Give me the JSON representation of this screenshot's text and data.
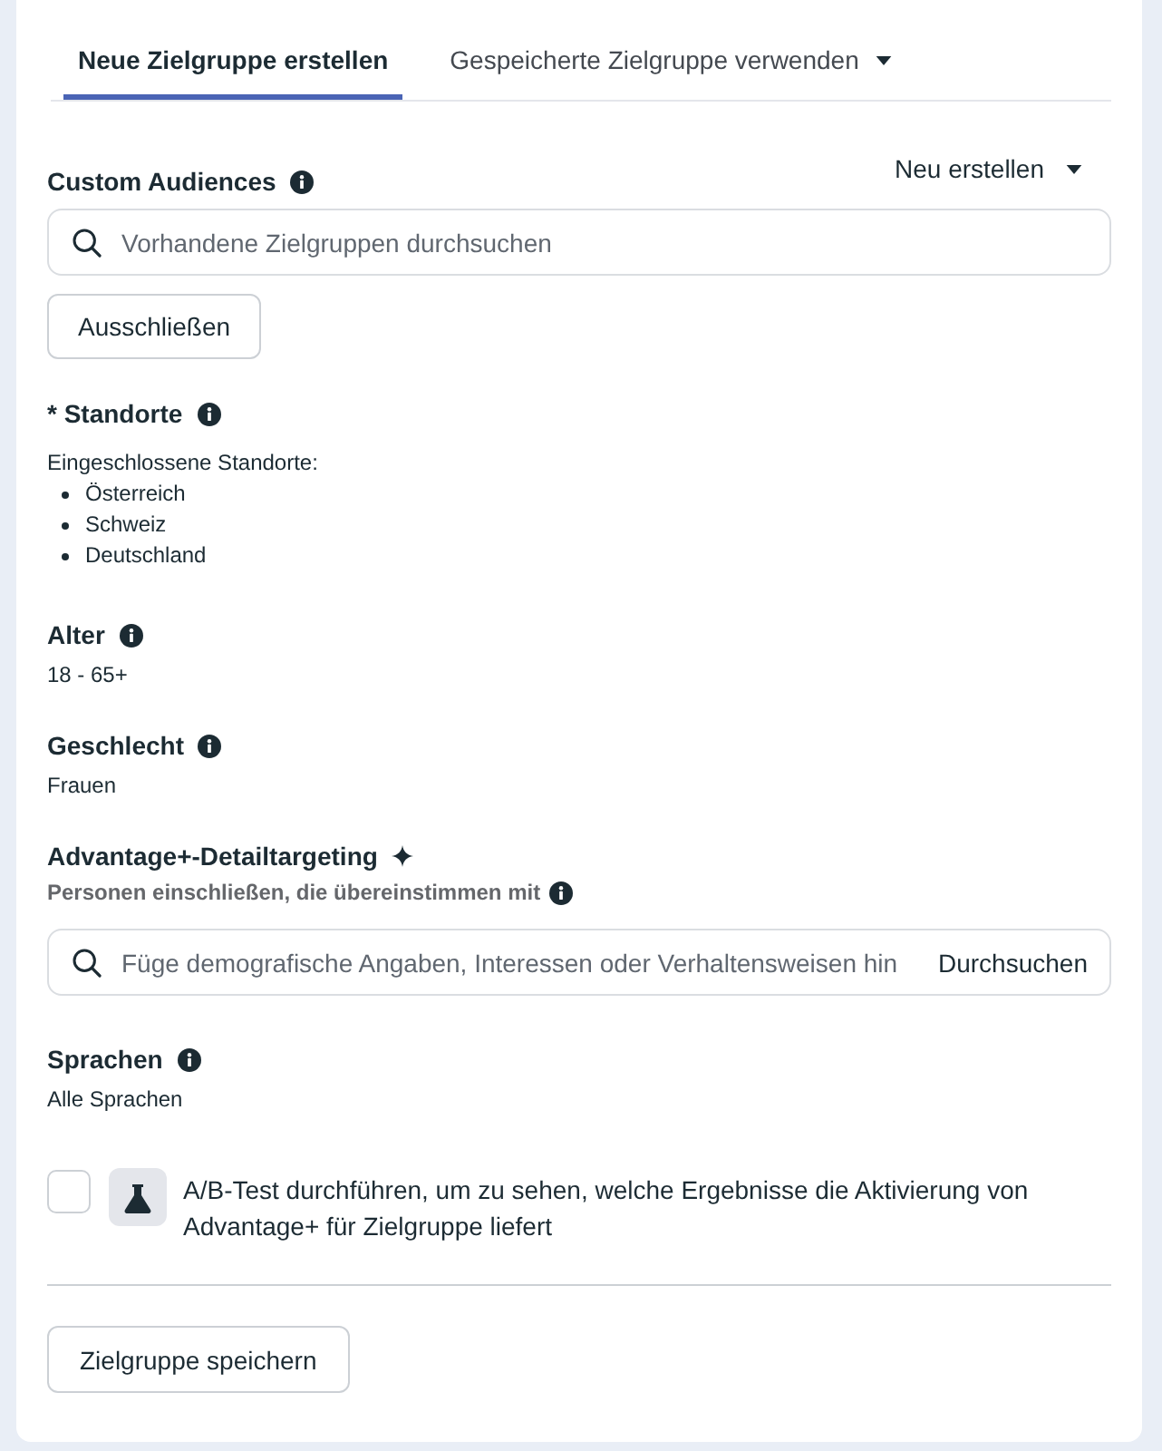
{
  "tabs": [
    {
      "label": "Neue Zielgruppe erstellen",
      "selected": true,
      "dropdown": false
    },
    {
      "label": "Gespeicherte Zielgruppe verwenden",
      "selected": false,
      "dropdown": true
    }
  ],
  "custom_audiences": {
    "title": "Custom Audiences",
    "menu_button": "Neu erstellen",
    "search": {
      "placeholder": "Vorhandene Zielgruppen durchsuchen"
    },
    "exclude_button": "Ausschließen"
  },
  "sections": [
    {
      "kind": "list",
      "title": "* Standorte",
      "label": "Eingeschlossene Standorte:",
      "items": [
        "Österreich",
        "Schweiz",
        "Deutschland"
      ]
    },
    {
      "kind": "value",
      "title": "Alter",
      "value": "18 - 65+"
    },
    {
      "kind": "value",
      "title": "Geschlecht",
      "value": "Frauen"
    },
    {
      "kind": "search",
      "title": "Advantage+-Detailtargeting",
      "subtitle": "Personen einschließen, die übereinstimmen mit",
      "search": {
        "placeholder": "Füge demografische Angaben, Interessen oder Verhaltensweisen hin",
        "action": "Durchsuchen"
      }
    },
    {
      "kind": "value",
      "title": "Sprachen",
      "value": "Alle Sprachen"
    }
  ],
  "ab_test": {
    "checked": false,
    "text": "A/B-Test durchführen, um zu sehen, welche Ergebnisse die Aktivierung von Advantage+ für Zielgruppe liefert"
  },
  "save_button": "Zielgruppe speichern"
}
